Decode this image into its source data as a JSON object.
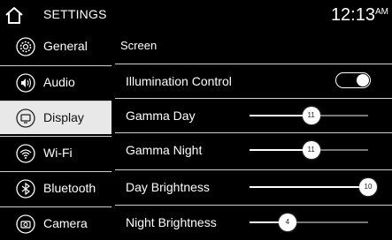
{
  "header": {
    "title": "SETTINGS",
    "time": "12:13",
    "ampm": "AM"
  },
  "sidebar": {
    "items": [
      {
        "label": "General",
        "icon": "gear-icon",
        "active": false
      },
      {
        "label": "Audio",
        "icon": "speaker-icon",
        "active": false
      },
      {
        "label": "Display",
        "icon": "display-icon",
        "active": true
      },
      {
        "label": "Wi-Fi",
        "icon": "wifi-icon",
        "active": false
      },
      {
        "label": "Bluetooth",
        "icon": "bluetooth-icon",
        "active": false
      },
      {
        "label": "Camera",
        "icon": "camera-icon",
        "active": false
      }
    ]
  },
  "main": {
    "section_title": "Screen",
    "rows": [
      {
        "label": "Illumination Control",
        "type": "toggle",
        "on": true
      },
      {
        "label": "Gamma Day",
        "type": "slider",
        "value": "11",
        "fraction": 0.52
      },
      {
        "label": "Gamma Night",
        "type": "slider",
        "value": "11",
        "fraction": 0.52
      },
      {
        "label": "Day Brightness",
        "type": "slider",
        "value": "10",
        "fraction": 1.0
      },
      {
        "label": "Night Brightness",
        "type": "slider",
        "value": "4",
        "fraction": 0.32
      }
    ]
  },
  "colors": {
    "active_bg": "#e8e8e8",
    "background": "#000000",
    "divider": "#cfcfcf"
  }
}
